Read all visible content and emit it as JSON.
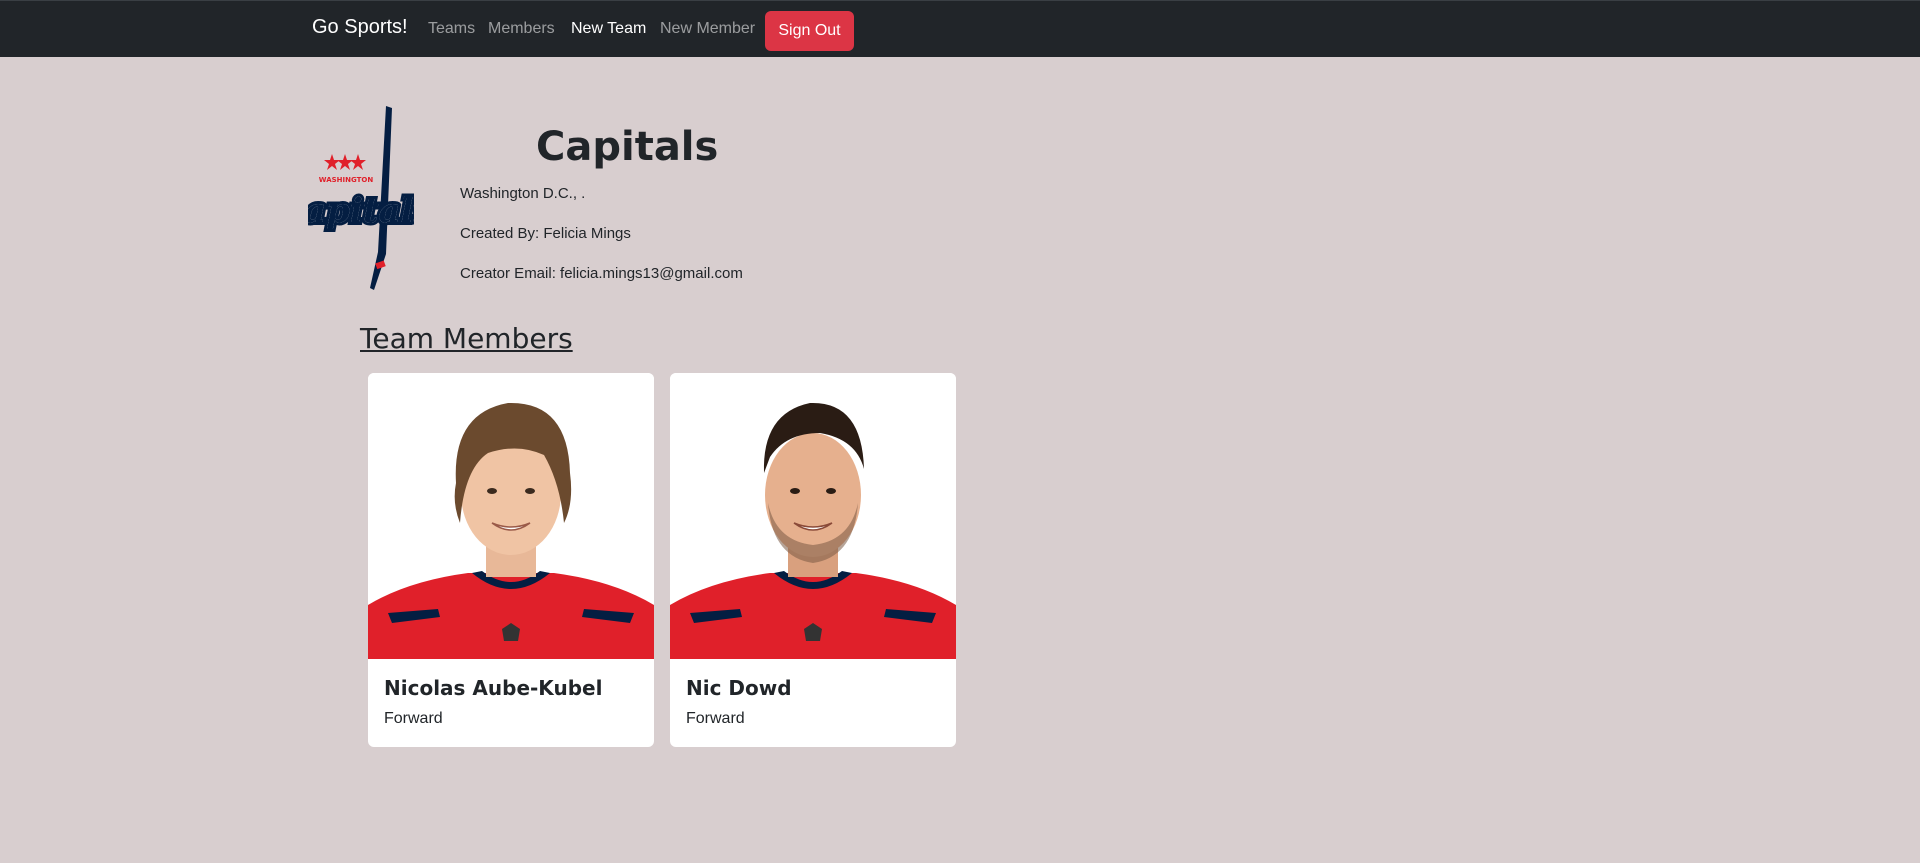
{
  "navbar": {
    "brand": "Go Sports!",
    "links": [
      {
        "label": "Teams",
        "active": false
      },
      {
        "label": "Members",
        "active": false
      },
      {
        "label": "New Team",
        "active": true
      },
      {
        "label": "New Member",
        "active": false
      }
    ],
    "signout_label": "Sign Out"
  },
  "team": {
    "name": "Capitals",
    "location": "Washington D.C., .",
    "created_by": "Created By: Felicia Mings",
    "creator_email": "Creator Email: felicia.mings13@gmail.com",
    "logo_text": "WASHINGTON capitals"
  },
  "members_section": {
    "title": "Team Members",
    "members": [
      {
        "name": "Nicolas Aube-Kubel",
        "position": "Forward"
      },
      {
        "name": "Nic Dowd",
        "position": "Forward"
      }
    ]
  },
  "colors": {
    "background": "#d8cecf",
    "navbar": "#212529",
    "signout": "#dc3545",
    "jersey": "#e0202a",
    "navy": "#041e42"
  }
}
